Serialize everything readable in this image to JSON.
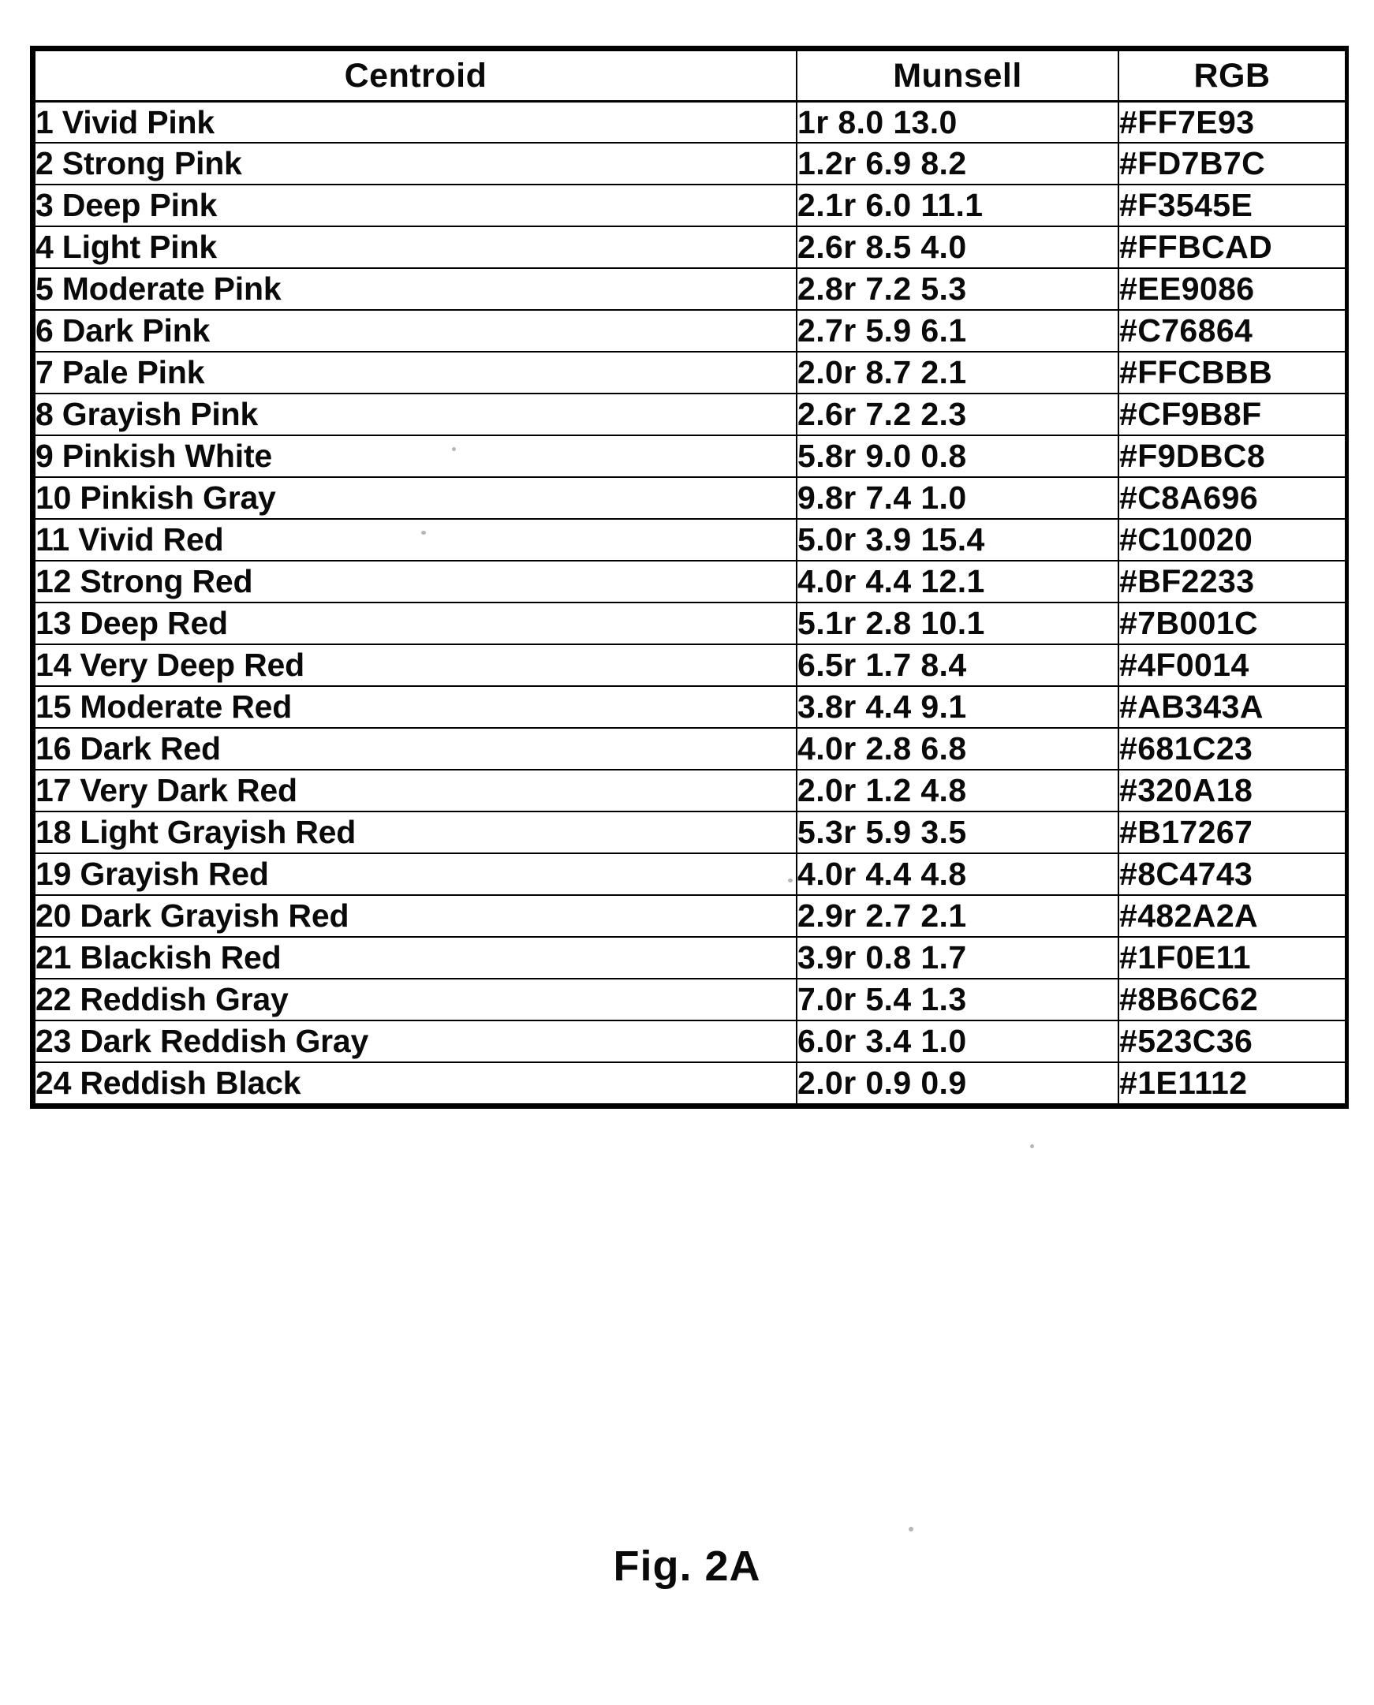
{
  "figure": {
    "caption": "Fig. 2A"
  },
  "table": {
    "columns": [
      "Centroid",
      "Munsell",
      "RGB"
    ],
    "rows": [
      {
        "centroid": "1 Vivid Pink",
        "munsell": "1r 8.0 13.0",
        "rgb": "#FF7E93"
      },
      {
        "centroid": "2 Strong Pink",
        "munsell": "1.2r 6.9 8.2",
        "rgb": "#FD7B7C"
      },
      {
        "centroid": "3 Deep Pink",
        "munsell": "2.1r 6.0 11.1",
        "rgb": "#F3545E"
      },
      {
        "centroid": "4 Light Pink",
        "munsell": "2.6r 8.5 4.0",
        "rgb": "#FFBCAD"
      },
      {
        "centroid": "5 Moderate Pink",
        "munsell": "2.8r 7.2 5.3",
        "rgb": "#EE9086"
      },
      {
        "centroid": "6 Dark Pink",
        "munsell": "2.7r 5.9 6.1",
        "rgb": "#C76864"
      },
      {
        "centroid": "7 Pale Pink",
        "munsell": "2.0r 8.7 2.1",
        "rgb": "#FFCBBB"
      },
      {
        "centroid": "8 Grayish Pink",
        "munsell": "2.6r 7.2 2.3",
        "rgb": "#CF9B8F"
      },
      {
        "centroid": "9 Pinkish White",
        "munsell": "5.8r 9.0 0.8",
        "rgb": "#F9DBC8"
      },
      {
        "centroid": "10 Pinkish Gray",
        "munsell": "9.8r 7.4 1.0",
        "rgb": "#C8A696"
      },
      {
        "centroid": "11 Vivid Red",
        "munsell": "5.0r 3.9 15.4",
        "rgb": "#C10020"
      },
      {
        "centroid": "12 Strong Red",
        "munsell": "4.0r 4.4 12.1",
        "rgb": "#BF2233"
      },
      {
        "centroid": "13 Deep Red",
        "munsell": "5.1r 2.8 10.1",
        "rgb": "#7B001C"
      },
      {
        "centroid": "14 Very Deep Red",
        "munsell": "6.5r 1.7 8.4",
        "rgb": "#4F0014"
      },
      {
        "centroid": "15 Moderate Red",
        "munsell": "3.8r 4.4 9.1",
        "rgb": "#AB343A"
      },
      {
        "centroid": "16 Dark Red",
        "munsell": "4.0r 2.8 6.8",
        "rgb": "#681C23"
      },
      {
        "centroid": "17 Very Dark Red",
        "munsell": "2.0r 1.2 4.8",
        "rgb": "#320A18"
      },
      {
        "centroid": "18 Light Grayish Red",
        "munsell": "5.3r 5.9 3.5",
        "rgb": "#B17267"
      },
      {
        "centroid": "19 Grayish Red",
        "munsell": "4.0r 4.4 4.8",
        "rgb": "#8C4743"
      },
      {
        "centroid": "20 Dark Grayish Red",
        "munsell": "2.9r 2.7 2.1",
        "rgb": "#482A2A"
      },
      {
        "centroid": "21 Blackish Red",
        "munsell": "3.9r 0.8 1.7",
        "rgb": "#1F0E11"
      },
      {
        "centroid": "22 Reddish Gray",
        "munsell": "7.0r 5.4 1.3",
        "rgb": "#8B6C62"
      },
      {
        "centroid": "23 Dark Reddish Gray",
        "munsell": "6.0r 3.4 1.0",
        "rgb": "#523C36"
      },
      {
        "centroid": "24 Reddish Black",
        "munsell": "2.0r 0.9 0.9",
        "rgb": "#1E1112"
      }
    ]
  }
}
